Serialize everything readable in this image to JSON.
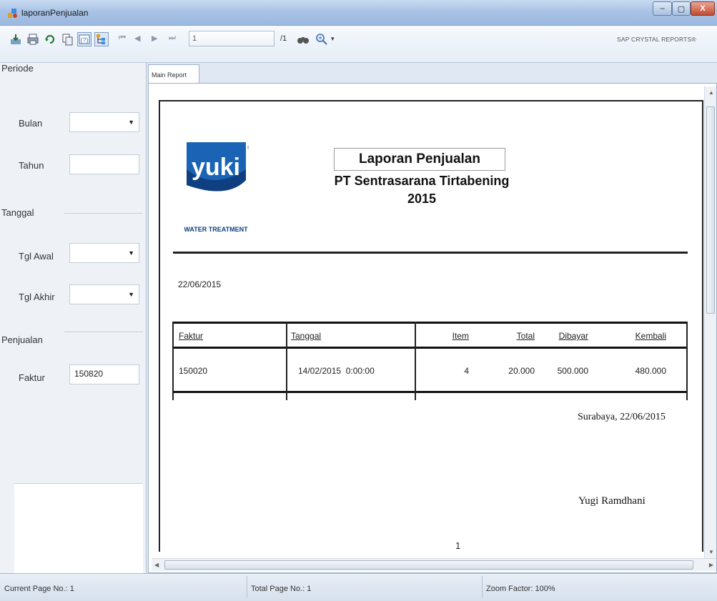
{
  "window": {
    "title": "laporanPenjualan",
    "minimize": "–",
    "maximize": "▢",
    "close": "X"
  },
  "toolbar": {
    "page_current": "1",
    "page_total": "/1",
    "brand": "SAP CRYSTAL REPORTS®",
    "icons": [
      "export-icon",
      "print-icon",
      "refresh-icon",
      "copy-icon",
      "parameter-panel-icon",
      "group-tree-icon",
      "first-page-icon",
      "prev-page-icon",
      "next-page-icon",
      "last-page-icon",
      "find-icon",
      "zoom-icon"
    ]
  },
  "params": {
    "periode": {
      "header": "Periode",
      "bulan_label": "Bulan",
      "bulan_value": "",
      "tahun_label": "Tahun",
      "tahun_value": ""
    },
    "tanggal": {
      "header": "Tanggal",
      "awal_label": "Tgl Awal",
      "awal_value": "",
      "akhir_label": "Tgl Akhir",
      "akhir_value": ""
    },
    "penjualan": {
      "header": "Penjualan",
      "faktur_label": "Faktur",
      "faktur_value": "150820"
    }
  },
  "report": {
    "tab": "Main Report",
    "logo_text": "yuki",
    "logo_sub": "WATER TREATMENT",
    "title": "Laporan Penjualan",
    "company": "PT Sentrasarana Tirtabening",
    "year": "2015",
    "date": "22/06/2015",
    "table": {
      "headers": [
        "Faktur",
        "Tanggal",
        "Item",
        "Total",
        "Dibayar",
        "Kembali"
      ],
      "rows": [
        [
          "150020",
          "14/02/2015  0:00:00",
          "4",
          "20.000",
          "500.000",
          "480.000"
        ]
      ]
    },
    "signature_place": "Surabaya, 22/06/2015",
    "signature_name": "Yugi Ramdhani",
    "page_number": "1"
  },
  "status": {
    "current_page": "Current Page No.: 1",
    "total_page": "Total Page No.: 1",
    "zoom": "Zoom Factor: 100%"
  },
  "colors": {
    "accent": "#1f5fa8",
    "logo_blue": "#1b64b5",
    "titlebar": "#a9c3e6"
  }
}
